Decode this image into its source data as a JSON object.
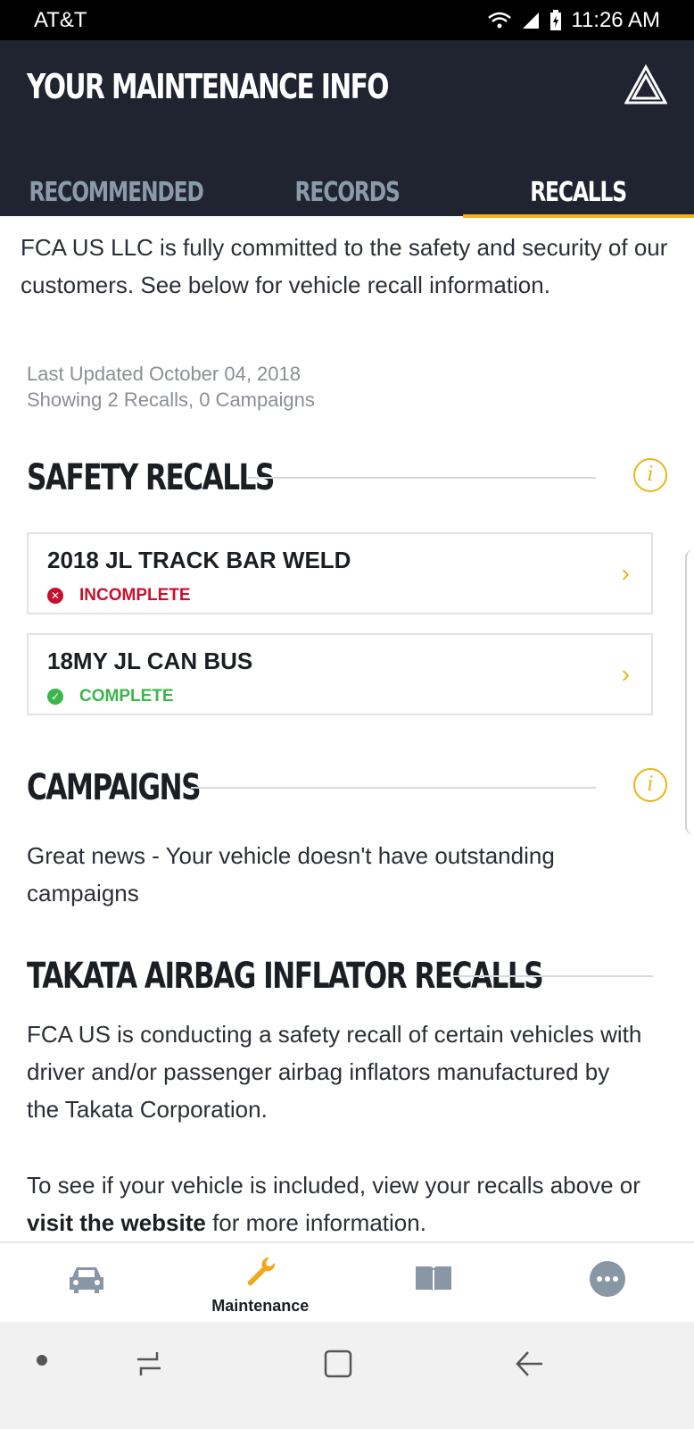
{
  "status_bar": {
    "carrier": "AT&T",
    "time": "11:26 AM"
  },
  "header": {
    "title": "YOUR MAINTENANCE INFO"
  },
  "tabs": [
    {
      "label": "RECOMMENDED",
      "active": false
    },
    {
      "label": "RECORDS",
      "active": false
    },
    {
      "label": "RECALLS",
      "active": true
    }
  ],
  "intro": "FCA US LLC is fully committed to the safety and security of our customers. See below for vehicle recall information.",
  "meta": {
    "last_updated": "Last Updated October 04, 2018",
    "showing": "Showing 2 Recalls, 0 Campaigns"
  },
  "safety_recalls": {
    "title": "SAFETY RECALLS",
    "items": [
      {
        "name": "2018 JL TRACK BAR WELD",
        "status": "INCOMPLETE",
        "status_color": "#c8102e"
      },
      {
        "name": "18MY JL CAN BUS",
        "status": "COMPLETE",
        "status_color": "#3cb64a"
      }
    ]
  },
  "campaigns": {
    "title": "CAMPAIGNS",
    "text": "Great news - Your vehicle doesn't have outstanding campaigns"
  },
  "takata": {
    "title": "TAKATA AIRBAG INFLATOR RECALLS",
    "paragraph1": "FCA US is conducting a safety recall of certain vehicles with driver and/or passenger airbag inflators manufactured by the Takata Corporation.",
    "paragraph2_pre": "To see if your vehicle is included, view your recalls above or ",
    "link_text": "visit the website",
    "paragraph2_post": " for more information."
  },
  "bottom_nav": {
    "items": [
      {
        "icon": "car-icon",
        "label": ""
      },
      {
        "icon": "wrench-icon",
        "label": "Maintenance"
      },
      {
        "icon": "book-icon",
        "label": ""
      },
      {
        "icon": "more-icon",
        "label": ""
      }
    ]
  },
  "colors": {
    "accent": "#f2b517",
    "header_bg": "#1f2430",
    "incomplete": "#c8102e",
    "complete": "#3cb64a"
  }
}
